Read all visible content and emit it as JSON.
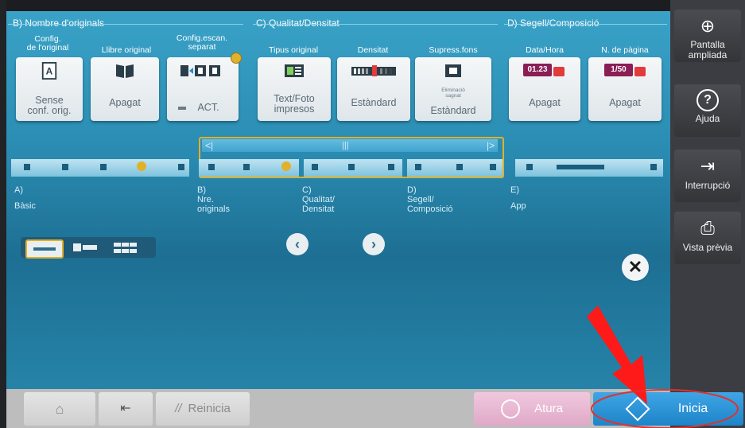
{
  "sections": {
    "b": {
      "title": "B)  Nombre d'originals",
      "opts": [
        {
          "label": "Config.\nde l'original",
          "value": "Sense\nconf. orig.",
          "icon": "document-a-icon"
        },
        {
          "label": "Llibre original",
          "value": "Apagat",
          "icon": "book-icon"
        },
        {
          "label": "Config.escan.\nseparat",
          "value": "ACT.",
          "icon": "separate-scan-icon"
        }
      ]
    },
    "c": {
      "title": "C)  Qualitat/Densitat",
      "opts": [
        {
          "label": "Tipus original",
          "value": "Text/Foto\nimpresos",
          "icon": "text-photo-icon"
        },
        {
          "label": "Densitat",
          "value": "Estàndard",
          "icon": "density-icon"
        },
        {
          "label": "Supress.fons",
          "value": "Estàndard",
          "icon": "background-removal-icon",
          "icon_text": "Eliminació\nsagnat"
        }
      ]
    },
    "d": {
      "title": "D)  Segell/Composició",
      "opts": [
        {
          "label": "Data/Hora",
          "value": "Apagat",
          "icon": "date-stamp-icon",
          "icon_text": "01.23"
        },
        {
          "label": "N. de pàgina",
          "value": "Apagat",
          "icon": "page-number-icon",
          "icon_text": "1/50"
        }
      ]
    }
  },
  "nav": {
    "items": [
      {
        "letter": "A)",
        "label": "Bàsic"
      },
      {
        "letter": "B)",
        "label": "Nre.\noriginals"
      },
      {
        "letter": "C)",
        "label": "Qualitat/\nDensitat"
      },
      {
        "letter": "D)",
        "label": "Segell/\nComposició"
      },
      {
        "letter": "E)",
        "label": "App"
      }
    ]
  },
  "side": {
    "zoom": "Pantalla\nampliada",
    "help": "Ajuda",
    "interrupt": "Interrupció",
    "preview": "Vista prèvia"
  },
  "bottom": {
    "reset": "Reinicia",
    "stop": "Atura",
    "start": "Inicia"
  },
  "colors": {
    "accent": "#1e8fd6",
    "highlight": "#e0b12a",
    "stop_pink": "#e8b9d3",
    "annotation_red": "#ff1a1a"
  }
}
